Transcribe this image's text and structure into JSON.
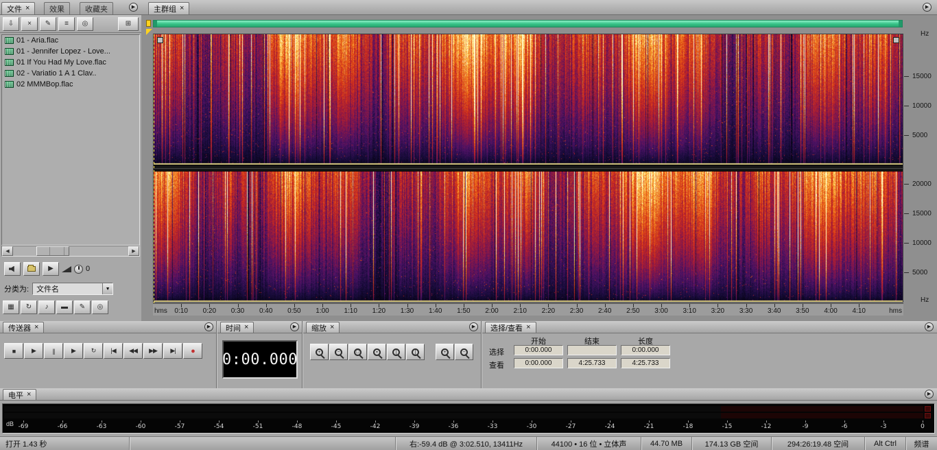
{
  "colors": {
    "range_bar_green": "#35c287",
    "record_red": "#c23030",
    "spectro_background": "#0a0416"
  },
  "left_panel": {
    "tabs": [
      {
        "label": "文件",
        "close": "×"
      },
      {
        "label": "效果"
      },
      {
        "label": "收藏夹"
      }
    ],
    "files": [
      "01 - Aria.flac",
      "01 - Jennifer Lopez - Love...",
      "01 If You Had My Love.flac",
      "02 - Variatio 1 A 1 Clav..",
      "02 MMMBop.flac"
    ],
    "sort_label": "分类为:",
    "sort_value": "文件名",
    "volume_value": "0"
  },
  "main": {
    "tab": "主群组",
    "tab_close": "×",
    "freq_unit": "Hz",
    "freq_max": 22050,
    "freq_labels_top": [
      15000,
      10000,
      5000
    ],
    "freq_labels_bottom": [
      20000,
      15000,
      10000,
      5000
    ],
    "timeline_unit_left": "hms",
    "timeline_unit_right": "hms",
    "timeline_ticks": [
      "0:10",
      "0:20",
      "0:30",
      "0:40",
      "0:50",
      "1:00",
      "1:10",
      "1:20",
      "1:30",
      "1:40",
      "1:50",
      "2:00",
      "2:10",
      "2:20",
      "2:30",
      "2:40",
      "2:50",
      "3:00",
      "3:10",
      "3:20",
      "3:30",
      "3:40",
      "3:50",
      "4:00",
      "4:10"
    ],
    "duration_seconds": 265.733
  },
  "transport": {
    "title": "传送器",
    "close": "×",
    "buttons": [
      {
        "name": "stop",
        "glyph": "■"
      },
      {
        "name": "play",
        "glyph": "▶"
      },
      {
        "name": "pause",
        "glyph": "||"
      },
      {
        "name": "play-from-cursor",
        "glyph": "▶"
      },
      {
        "name": "loop-play",
        "glyph": "↻"
      },
      {
        "name": "go-to-beginning",
        "glyph": "|◀"
      },
      {
        "name": "rewind",
        "glyph": "◀◀"
      },
      {
        "name": "fast-forward",
        "glyph": "▶▶"
      },
      {
        "name": "go-to-end",
        "glyph": "▶|"
      },
      {
        "name": "record",
        "glyph": "●",
        "record": true
      }
    ]
  },
  "time_panel": {
    "title": "时间",
    "close": "×",
    "value": "0:00.000"
  },
  "zoom_panel": {
    "title": "缩放",
    "close": "×",
    "buttons_main": [
      {
        "name": "zoom-in-horizontal",
        "sym": "+"
      },
      {
        "name": "zoom-out-horizontal",
        "sym": "−"
      },
      {
        "name": "zoom-out-full",
        "sym": "□"
      },
      {
        "name": "zoom-to-selection",
        "sym": "▪"
      },
      {
        "name": "zoom-in-left-edge",
        "sym": "["
      },
      {
        "name": "zoom-in-right-edge",
        "sym": "]"
      }
    ],
    "buttons_vertical": [
      {
        "name": "zoom-in-vertical",
        "sym": "+"
      },
      {
        "name": "zoom-out-vertical",
        "sym": "−"
      }
    ]
  },
  "selection_panel": {
    "title": "选择/查看",
    "close": "×",
    "col_headers": [
      "开始",
      "结束",
      "长度"
    ],
    "rows": [
      {
        "label": "选择",
        "start": "0:00.000",
        "end": "",
        "length": "0:00.000"
      },
      {
        "label": "查看",
        "start": "0:00.000",
        "end": "4:25.733",
        "length": "4:25.733"
      }
    ]
  },
  "levels": {
    "title": "电平",
    "close": "×",
    "db_label": "dB",
    "scale": [
      -69,
      -66,
      -63,
      -60,
      -57,
      -54,
      -51,
      -48,
      -45,
      -42,
      -39,
      -36,
      -33,
      -30,
      -27,
      -24,
      -21,
      -18,
      -15,
      -12,
      -9,
      -6,
      -3,
      0
    ]
  },
  "status_bar": {
    "open_info": "打开 1.43 秒",
    "cursor_info": "右:-59.4 dB @  3:02.510, 13411Hz",
    "format_info": "44100 • 16 位 • 立体声",
    "file_size": "44.70 MB",
    "disk_free": "174.13 GB 空间",
    "time_free": "294:26:19.48 空间",
    "modifier_keys": "Alt Ctrl",
    "view_mode": "频谱"
  }
}
